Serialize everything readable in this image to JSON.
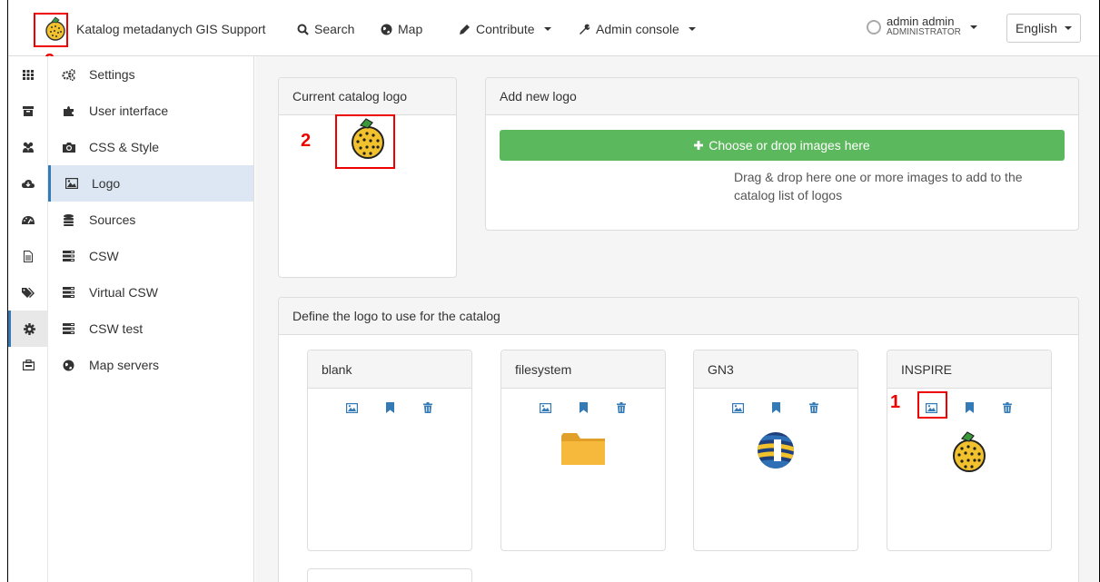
{
  "navbar": {
    "brand_name": "Katalog metadanych GIS Support",
    "items": [
      {
        "label": "Search",
        "icon": "search-icon"
      },
      {
        "label": "Map",
        "icon": "globe-icon"
      },
      {
        "label": "Contribute",
        "icon": "pencil-icon"
      },
      {
        "label": "Admin console",
        "icon": "wrench-icon"
      }
    ],
    "user_name": "admin admin",
    "user_role": "ADMINISTRATOR",
    "language": "English"
  },
  "annotations": {
    "marker_1": "1",
    "marker_2": "2"
  },
  "sidebar": {
    "rail_icons": [
      "grid-icon",
      "archive-icon",
      "users-icon",
      "cloud-icon",
      "dashboard-icon",
      "file-icon",
      "tags-icon",
      "gear-icon",
      "toolbox-icon"
    ],
    "active_rail_index": 7,
    "items": [
      {
        "label": "Settings",
        "icon": "gears-icon"
      },
      {
        "label": "User interface",
        "icon": "puzzle-icon"
      },
      {
        "label": "CSS & Style",
        "icon": "camera-icon"
      },
      {
        "label": "Logo",
        "icon": "picture-icon"
      },
      {
        "label": "Sources",
        "icon": "database-icon"
      },
      {
        "label": "CSW",
        "icon": "server-icon"
      },
      {
        "label": "Virtual CSW",
        "icon": "server-icon"
      },
      {
        "label": "CSW test",
        "icon": "server-icon"
      },
      {
        "label": "Map servers",
        "icon": "globe-icon"
      }
    ],
    "active_item": "Logo"
  },
  "current_logo": {
    "title": "Current catalog logo"
  },
  "add_logo": {
    "title": "Add new logo",
    "button_label": "Choose or drop images here",
    "hint": "Drag & drop here one or more images to add to the catalog list of logos"
  },
  "define_logo": {
    "title": "Define the logo to use for the catalog",
    "logos": [
      {
        "name": "blank",
        "image": "none"
      },
      {
        "name": "filesystem",
        "image": "folder-icon"
      },
      {
        "name": "GN3",
        "image": "gn3-globe-icon"
      },
      {
        "name": "INSPIRE",
        "image": "inspire-logo-icon"
      }
    ]
  },
  "colors": {
    "accent": "#337ab7",
    "success": "#5cb85c",
    "annotation": "#ee0000"
  }
}
